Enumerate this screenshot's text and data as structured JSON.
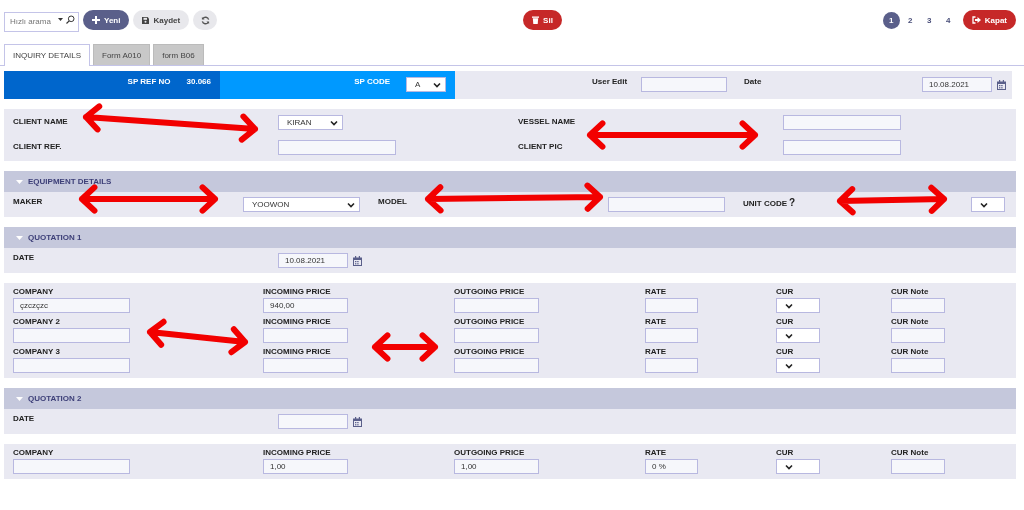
{
  "toolbar": {
    "search": {
      "placeholder": "Hızlı arama"
    },
    "buttons": [
      {
        "kind": "new",
        "label": "Yeni"
      },
      {
        "kind": "save",
        "label": "Kaydet"
      },
      {
        "kind": "refresh"
      }
    ],
    "delete_button": {
      "label": "Sil"
    },
    "pages": [
      {
        "label": "1",
        "selected": true
      },
      {
        "label": "2",
        "selected": false
      },
      {
        "label": "3",
        "selected": false
      },
      {
        "label": "4",
        "selected": false
      }
    ],
    "close_button": {
      "label": "Kapat"
    }
  },
  "tabs": [
    {
      "label": "INQUIRY DETAILS",
      "selected": true
    },
    {
      "label": "Form A010",
      "selected": false
    },
    {
      "label": "form B06",
      "selected": false
    }
  ],
  "header": {
    "sp_ref_no": {
      "label": "SP REF NO",
      "value": "30.066"
    },
    "sp_code": {
      "label": "SP CODE",
      "value": "A"
    },
    "user_edit": {
      "label": "User Edit"
    },
    "date": {
      "label": "Date",
      "value": "10.08.2021"
    }
  },
  "client": {
    "fields": [
      {
        "label": "CLIENT NAME",
        "kind": "select",
        "value": "KIRAN"
      },
      {
        "label": "VESSEL NAME",
        "kind": "input"
      },
      {
        "label": "CLIENT REF.",
        "kind": "input"
      },
      {
        "label": "CLIENT PIC",
        "kind": "input"
      }
    ]
  },
  "equipment": {
    "title": "EQUIPMENT DETAILS",
    "expanded": true,
    "fields": [
      {
        "label": "MAKER",
        "kind": "select",
        "value": "YOOWON"
      },
      {
        "label": "MODEL",
        "kind": "input"
      },
      {
        "label": "UNIT CODE",
        "help": "?",
        "kind": "select"
      }
    ]
  },
  "quotations": [
    {
      "title": "QUOTATION 1",
      "expanded": true,
      "date": {
        "label": "DATE",
        "value": "10.08.2021"
      },
      "rows": [
        {
          "cells": [
            {
              "label": "COMPANY",
              "kind": "input",
              "value": "çzczçzc"
            },
            {
              "label": "INCOMING PRICE",
              "kind": "input",
              "value": "940,00"
            },
            {
              "label": "OUTGOING PRICE",
              "kind": "input"
            },
            {
              "label": "RATE",
              "kind": "input"
            },
            {
              "label": "CUR",
              "kind": "select"
            },
            {
              "label": "CUR Note",
              "kind": "input"
            }
          ]
        },
        {
          "cells": [
            {
              "label": "COMPANY 2",
              "kind": "input"
            },
            {
              "label": "INCOMING PRICE",
              "kind": "input"
            },
            {
              "label": "OUTGOING PRICE",
              "kind": "input"
            },
            {
              "label": "RATE",
              "kind": "input"
            },
            {
              "label": "CUR",
              "kind": "select"
            },
            {
              "label": "CUR Note",
              "kind": "input"
            }
          ]
        },
        {
          "cells": [
            {
              "label": "COMPANY 3",
              "kind": "input"
            },
            {
              "label": "INCOMING PRICE",
              "kind": "input"
            },
            {
              "label": "OUTGOING PRICE",
              "kind": "input"
            },
            {
              "label": "RATE",
              "kind": "input"
            },
            {
              "label": "CUR",
              "kind": "select"
            },
            {
              "label": "CUR Note",
              "kind": "input"
            }
          ]
        }
      ]
    },
    {
      "title": "QUOTATION 2",
      "expanded": true,
      "date": {
        "label": "DATE"
      },
      "rows": [
        {
          "cells": [
            {
              "label": "COMPANY",
              "kind": "input"
            },
            {
              "label": "INCOMING PRICE",
              "kind": "input",
              "value": "1,00"
            },
            {
              "label": "OUTGOING PRICE",
              "kind": "input",
              "value": "1,00"
            },
            {
              "label": "RATE",
              "kind": "input",
              "value": "0 %"
            },
            {
              "label": "CUR",
              "kind": "select"
            },
            {
              "label": "CUR Note",
              "kind": "input"
            }
          ]
        }
      ]
    }
  ]
}
